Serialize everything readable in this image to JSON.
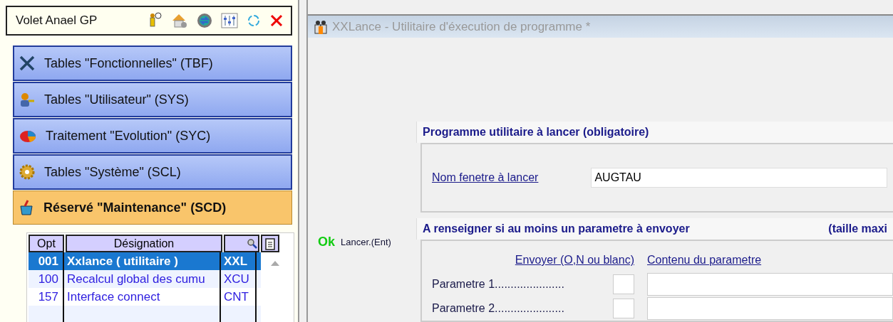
{
  "panel": {
    "title": "Volet Anael GP"
  },
  "menu": [
    {
      "label": "Tables \"Fonctionnelles\" (TBF)",
      "selected": false
    },
    {
      "label": "Tables \"Utilisateur\" (SYS)",
      "selected": false
    },
    {
      "label": "Traitement \"Evolution\" (SYC)",
      "selected": false
    },
    {
      "label": "Tables \"Système\" (SCL)",
      "selected": false
    },
    {
      "label": "Réservé \"Maintenance\" (SCD)",
      "selected": true
    }
  ],
  "table": {
    "columns": [
      "Opt",
      "Désignation"
    ],
    "rows": [
      {
        "opt": "001",
        "designation": "Xxlance ( utilitaire )",
        "code": "XXL",
        "selected": true
      },
      {
        "opt": "100",
        "designation": "Recalcul global des cumu",
        "code": "XCU",
        "selected": false
      },
      {
        "opt": "157",
        "designation": "Interface connect",
        "code": "CNT",
        "selected": false
      }
    ]
  },
  "window": {
    "title": "XXLance - Utilitaire d'éxecution de programme *"
  },
  "ok_button": {
    "label": "Ok",
    "caption": "Lancer.(Ent)"
  },
  "group1": {
    "title": "Programme utilitaire à lancer  (obligatoire)",
    "field_label": "Nom fenetre à lancer",
    "field_value": "AUGTAU"
  },
  "group2": {
    "title": "A renseigner si au moins un parametre à envoyer",
    "note": "(taille maxi",
    "col_send": "Envoyer (O,N ou blanc)",
    "col_content": "Contenu du parametre",
    "params": [
      {
        "label": "Parametre 1......................"
      },
      {
        "label": "Parametre 2......................"
      }
    ]
  }
}
